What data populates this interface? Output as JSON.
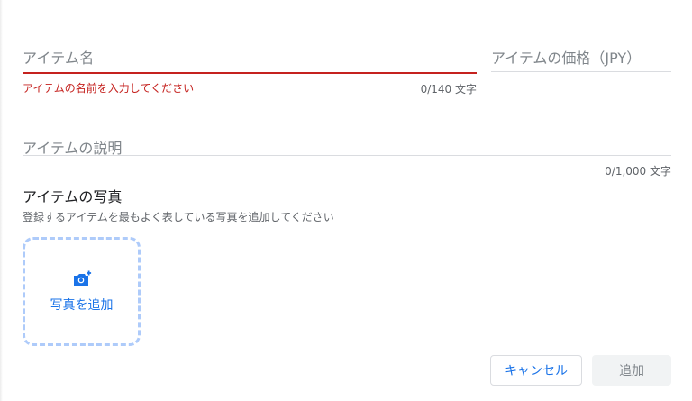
{
  "form": {
    "name_field": {
      "label": "アイテム名",
      "value": "",
      "error": "アイテムの名前を入力してください",
      "counter": "0/140 文字"
    },
    "price_field": {
      "label": "アイテムの価格（JPY）",
      "value": ""
    },
    "description_field": {
      "label": "アイテムの説明",
      "value": "",
      "counter": "0/1,000 文字"
    },
    "photo": {
      "title": "アイテムの写真",
      "hint": "登録するアイテムを最もよく表している写真を追加してください",
      "add_label": "写真を追加",
      "icon": "add-photo-icon"
    },
    "actions": {
      "cancel_label": "キャンセル",
      "add_label": "追加"
    }
  },
  "colors": {
    "error": "#c5221f",
    "accent": "#1a73e8",
    "dashed_border": "#aecbfa",
    "disabled_bg": "#f1f3f4",
    "disabled_text": "#80868b"
  }
}
